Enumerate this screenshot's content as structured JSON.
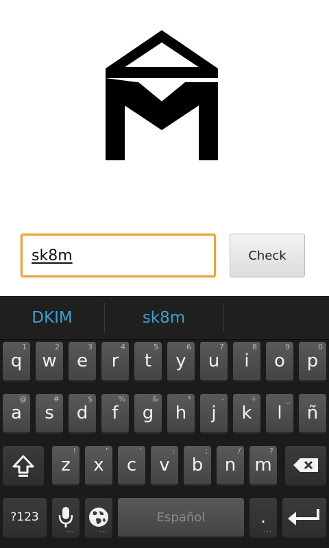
{
  "form": {
    "input_value": "sk8m",
    "check_label": "Check"
  },
  "keyboard": {
    "suggestions": [
      "DKIM",
      "sk8m"
    ],
    "rows": [
      [
        {
          "key": "q",
          "hint": "1"
        },
        {
          "key": "w",
          "hint": "2"
        },
        {
          "key": "e",
          "hint": "3"
        },
        {
          "key": "r",
          "hint": "4"
        },
        {
          "key": "t",
          "hint": "5"
        },
        {
          "key": "y",
          "hint": "6"
        },
        {
          "key": "u",
          "hint": "7"
        },
        {
          "key": "i",
          "hint": "8"
        },
        {
          "key": "o",
          "hint": "9"
        },
        {
          "key": "p",
          "hint": "0"
        }
      ],
      [
        {
          "key": "a",
          "hint": "@"
        },
        {
          "key": "s",
          "hint": "#"
        },
        {
          "key": "d",
          "hint": "$"
        },
        {
          "key": "f",
          "hint": "%"
        },
        {
          "key": "g",
          "hint": "&"
        },
        {
          "key": "h",
          "hint": "*"
        },
        {
          "key": "j",
          "hint": "-"
        },
        {
          "key": "k",
          "hint": "+"
        },
        {
          "key": "l",
          "hint": "_"
        },
        {
          "key": "ñ",
          "hint": ""
        }
      ],
      [
        {
          "key": "z",
          "hint": "!"
        },
        {
          "key": "x",
          "hint": "\""
        },
        {
          "key": "c",
          "hint": "'"
        },
        {
          "key": "v",
          "hint": ":"
        },
        {
          "key": "b",
          "hint": ";"
        },
        {
          "key": "n",
          "hint": "/"
        },
        {
          "key": "m",
          "hint": "?"
        }
      ]
    ],
    "symbols_label": "?123",
    "space_label": "Español",
    "period_label": ".",
    "icons": {
      "shift": "shift-icon",
      "backspace": "backspace-icon",
      "mic": "mic-icon",
      "globe": "globe-icon",
      "enter": "enter-icon"
    }
  }
}
